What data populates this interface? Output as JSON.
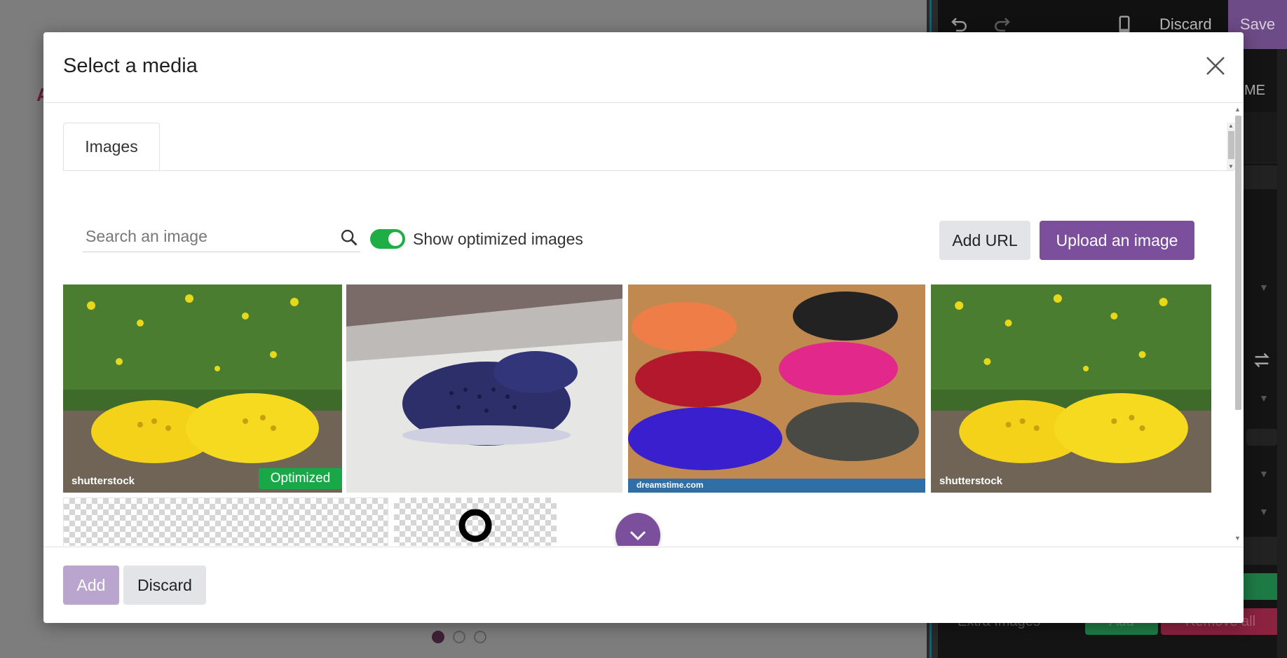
{
  "background": {
    "page_letter": "A",
    "carousel_dots": 3
  },
  "editor": {
    "discard_label": "Discard",
    "save_label": "Save",
    "tab_fragment": "ME",
    "extra_images_label": "Extra Images",
    "add_label": "Add",
    "remove_all_label": "Remove all"
  },
  "modal": {
    "title": "Select a media",
    "close_icon": "close-icon",
    "tabs": [
      {
        "label": "Images"
      }
    ],
    "search": {
      "placeholder": "Search an image",
      "value": ""
    },
    "toggle": {
      "label": "Show optimized images",
      "checked": true,
      "color": "#1fae45"
    },
    "buttons": {
      "add_url": "Add URL",
      "upload": "Upload an image"
    },
    "images": [
      {
        "desc": "yellow-clogs",
        "badge": "Optimized",
        "watermark": "shutterstock"
      },
      {
        "desc": "navy-clog",
        "badge": "",
        "watermark": ""
      },
      {
        "desc": "colorful-clogs",
        "badge": "",
        "watermark": "dreamstime.com"
      },
      {
        "desc": "yellow-clogs",
        "badge": "",
        "watermark": "shutterstock"
      }
    ],
    "footer": {
      "add": "Add",
      "discard": "Discard"
    }
  },
  "colors": {
    "accent": "#7b4f9c",
    "success": "#18a847"
  }
}
